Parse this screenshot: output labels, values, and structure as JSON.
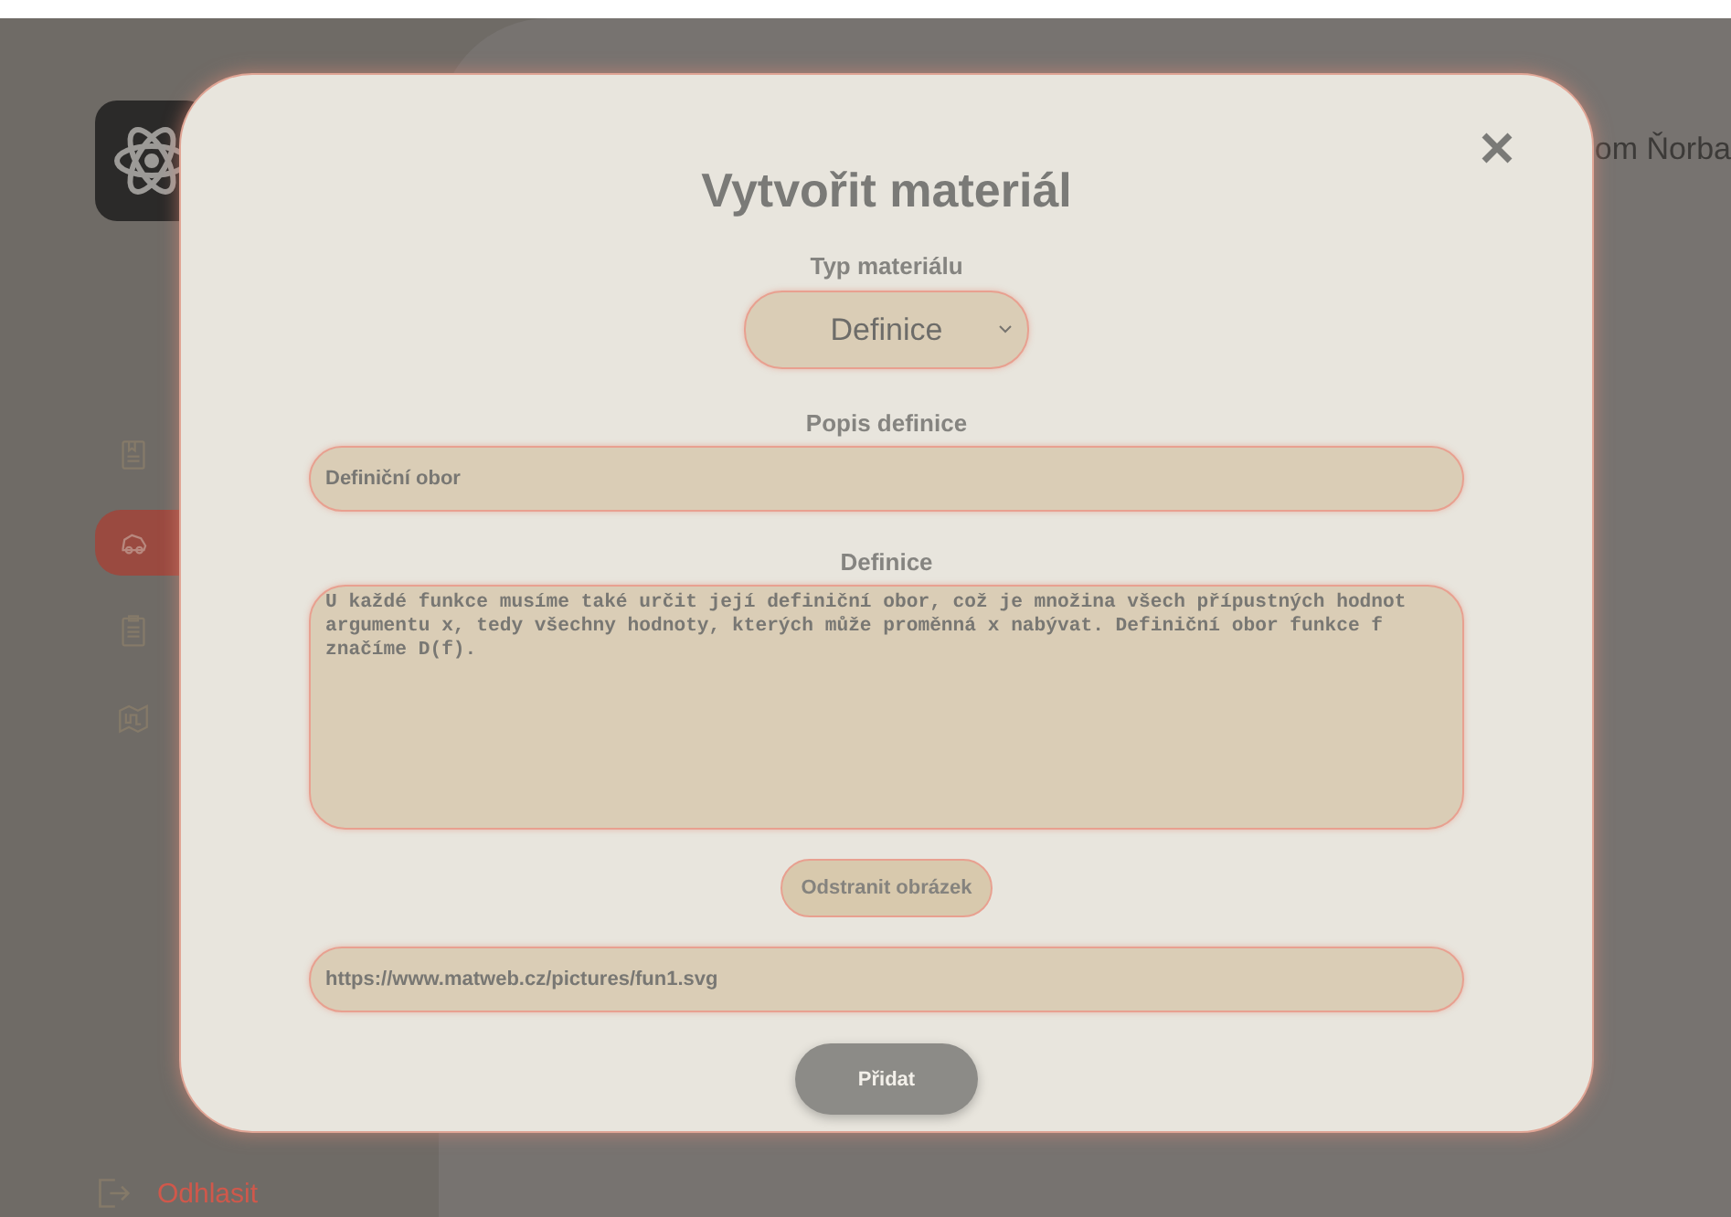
{
  "sidebar": {
    "items": [
      {
        "kind": "document",
        "selected": false
      },
      {
        "kind": "car",
        "selected": true
      },
      {
        "kind": "clipboard",
        "selected": false
      },
      {
        "kind": "map",
        "selected": false
      }
    ],
    "logout": "Odhlasit"
  },
  "header": {
    "user": "om Ňorba"
  },
  "modal": {
    "title": "Vytvořit materiál",
    "type_label": "Typ materiálu",
    "type_value": "Definice",
    "description_label": "Popis definice",
    "description_value": "Definiční obor",
    "definition_label": "Definice",
    "definition_value": "U každé funkce musíme také určit její definiční obor, což je množina všech přípustných hodnot argumentu x, tedy všechny hodnoty, kterých může proměnná x nabývat. Definiční obor funkce f značíme D(f).",
    "remove_image_button": "Odstranit obrázek",
    "image_url": "https://www.matweb.cz/pictures/fun1.svg",
    "submit_button": "Přidat"
  }
}
